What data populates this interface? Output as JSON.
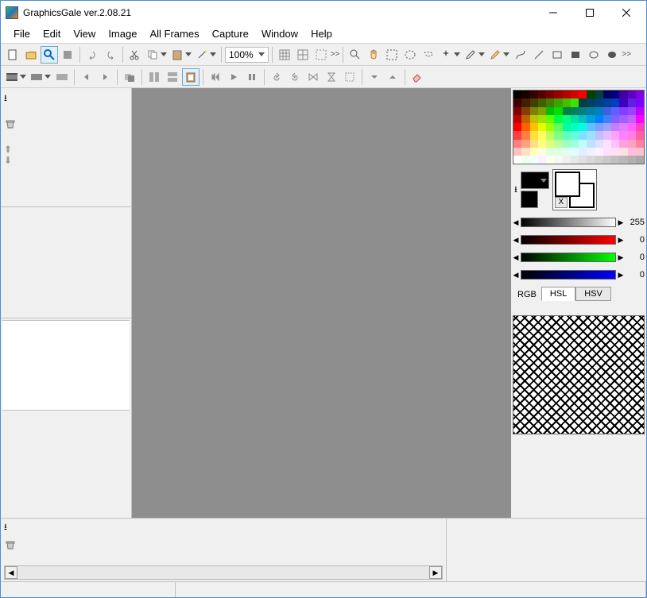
{
  "window": {
    "title": "GraphicsGale ver.2.08.21"
  },
  "menu": {
    "file": "File",
    "edit": "Edit",
    "view": "View",
    "image": "Image",
    "allframes": "All Frames",
    "capture": "Capture",
    "window": "Window",
    "help": "Help"
  },
  "toolbar": {
    "zoom": "100%"
  },
  "color": {
    "gray_val": "255",
    "r_val": "0",
    "g_val": "0",
    "b_val": "0",
    "tab_rgb": "RGB",
    "tab_hsl": "HSL",
    "tab_hsv": "HSV",
    "x": "X"
  },
  "palette_colors": [
    "#000000",
    "#180000",
    "#380000",
    "#580000",
    "#780000",
    "#980000",
    "#b80000",
    "#d80000",
    "#f80000",
    "#004000",
    "#004040",
    "#000060",
    "#000080",
    "#4000a0",
    "#6000c0",
    "#8000e0",
    "#400000",
    "#402000",
    "#404000",
    "#406000",
    "#408000",
    "#40a000",
    "#40c000",
    "#40e000",
    "#004040",
    "#004060",
    "#004080",
    "#0040a0",
    "#0040c0",
    "#4000c0",
    "#6020e0",
    "#8000ff",
    "#800000",
    "#804000",
    "#808000",
    "#80a000",
    "#00c000",
    "#00e000",
    "#008040",
    "#008060",
    "#008080",
    "#0080a0",
    "#0080c0",
    "#4060e0",
    "#6060ff",
    "#8040ff",
    "#a040ff",
    "#c000ff",
    "#c00000",
    "#c06000",
    "#c0c000",
    "#a0e000",
    "#60ff00",
    "#00ff40",
    "#00ff80",
    "#00e0a0",
    "#00c0c0",
    "#00a0e0",
    "#0080ff",
    "#4080ff",
    "#8060ff",
    "#a060ff",
    "#c060ff",
    "#ff00ff",
    "#ff0000",
    "#ff6000",
    "#ffc000",
    "#e0ff00",
    "#a0ff00",
    "#60ff60",
    "#00ffa0",
    "#00ffc0",
    "#00ffe0",
    "#60c0ff",
    "#80a0ff",
    "#a0a0ff",
    "#c080ff",
    "#e080ff",
    "#ff60ff",
    "#ff40c0",
    "#ff4040",
    "#ff8040",
    "#ffe040",
    "#ffff60",
    "#c0ff60",
    "#80ff80",
    "#60ffc0",
    "#60ffe0",
    "#80e0ff",
    "#a0e0ff",
    "#c0c0ff",
    "#e0c0ff",
    "#ffa0ff",
    "#ff80ff",
    "#ff80e0",
    "#ff60a0",
    "#ff8080",
    "#ffa080",
    "#ffe080",
    "#ffff80",
    "#e0ff80",
    "#c0ffa0",
    "#a0ffc0",
    "#a0ffe0",
    "#c0ffff",
    "#c0e0ff",
    "#e0e0ff",
    "#ffe0ff",
    "#ffc0ff",
    "#ffa0e0",
    "#ffa0c0",
    "#ff80a0",
    "#ffc0c0",
    "#ffe0c0",
    "#ffffc0",
    "#ffffe0",
    "#e0ffe0",
    "#e0ffe0",
    "#e0fff0",
    "#e0ffff",
    "#e0f0ff",
    "#f0f0ff",
    "#fff0ff",
    "#ffe0ff",
    "#ffe0f0",
    "#ffe0e0",
    "#ffc0e0",
    "#ffc0d0",
    "#ffffff",
    "#f0fff0",
    "#f0ffff",
    "#fff0ff",
    "#fffff0",
    "#f8f8f8",
    "#f0f0f0",
    "#e8e8e8",
    "#e0e0e0",
    "#d8d8d8",
    "#d0d0d0",
    "#c8c8c8",
    "#c0c0c0",
    "#b8b8b8",
    "#b0b0b0",
    "#a8a8a8"
  ]
}
